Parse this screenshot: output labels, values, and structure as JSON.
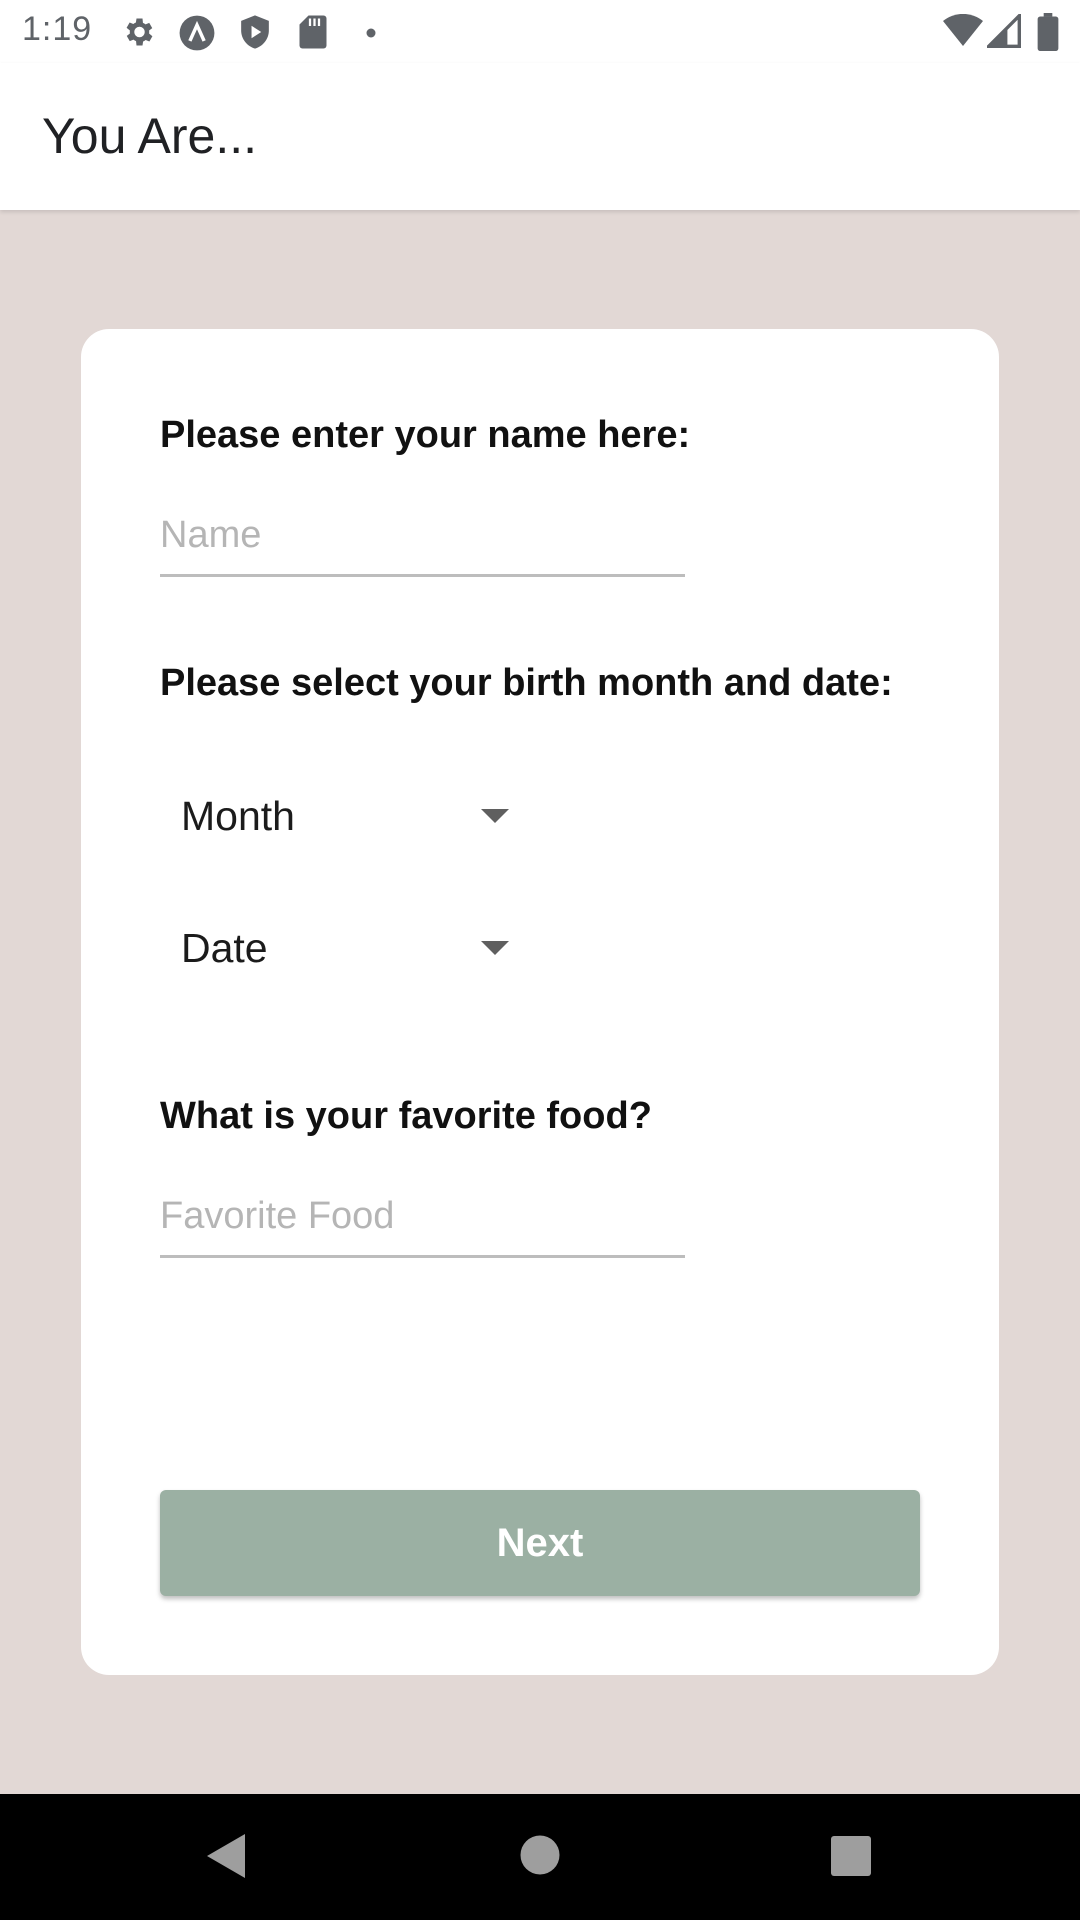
{
  "status_bar": {
    "time": "1:19",
    "left_icons": [
      "gear-icon",
      "assistant-icon",
      "shield-play-icon",
      "sd-card-icon",
      "dot-icon"
    ],
    "right_icons": [
      "wifi-icon",
      "cell-signal-icon",
      "battery-icon"
    ]
  },
  "app_bar": {
    "title": "You Are..."
  },
  "form": {
    "name_label": "Please enter your name here:",
    "name_placeholder": "Name",
    "birth_label": "Please select your birth month and date:",
    "month_value": "Month",
    "date_value": "Date",
    "food_label": "What is your favorite food?",
    "food_placeholder": "Favorite Food",
    "next_label": "Next"
  },
  "colors": {
    "background": "#e2d8d5",
    "card": "#ffffff",
    "button": "#9bb0a3"
  },
  "nav_bar": {
    "buttons": [
      "back-icon",
      "home-icon",
      "recents-icon"
    ]
  }
}
